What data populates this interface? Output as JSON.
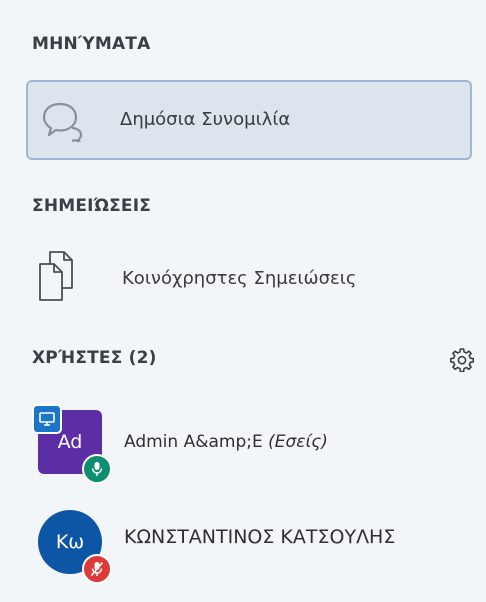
{
  "messages": {
    "title": "ΜΗΝΎΜΑΤΑ",
    "public_chat_label": "Δημόσια Συνομιλία"
  },
  "notes": {
    "title": "ΣΗΜΕΙΏΣΕΙΣ",
    "shared_notes_label": "Κοινόχρηστες Σημειώσεις"
  },
  "users": {
    "title": "ΧΡΉΣΤΕΣ (2)",
    "list": [
      {
        "initials": "Ad",
        "name": "Admin A&amp;E",
        "you_label": "(Εσείς)",
        "avatar_color": "#5b2ea6",
        "mic_color": "#0c8f6e"
      },
      {
        "initials": "Κω",
        "name": "ΚΩΝΣΤΑΝΤΙΝΟΣ ΚΑΤΣΟΥΛΗΣ",
        "avatar_color": "#0d55a5",
        "mic_color": "#dd3a3a"
      }
    ]
  },
  "icons": {
    "chat": "chat-bubbles-icon",
    "notes": "documents-icon",
    "settings": "gear-icon",
    "presenter": "presenter-screen-icon",
    "mic_on": "microphone-icon",
    "mic_muted": "microphone-muted-icon"
  }
}
